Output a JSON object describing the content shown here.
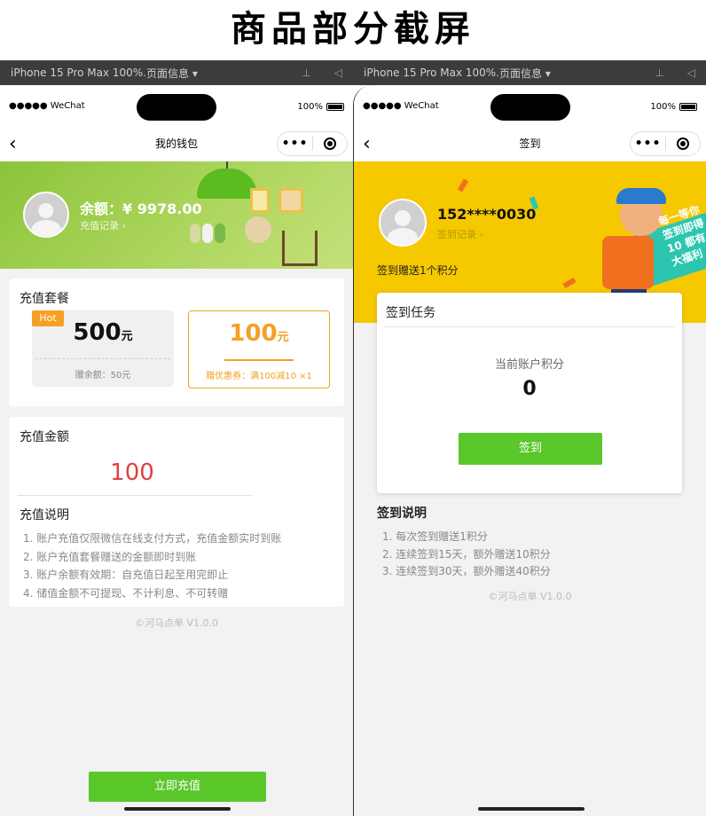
{
  "heading": "商品部分截屏",
  "devtools": {
    "device_label": "iPhone 15 Pro Max 100%...",
    "menu_label": "页面信息 ▾",
    "pin_icon": "pin-icon",
    "speaker_icon": "speaker-icon"
  },
  "status_bar": {
    "carrier": "●●●●● WeChat",
    "battery_pct": "100%"
  },
  "wallet": {
    "nav_title": "我的钱包",
    "back_glyph": "‹",
    "capsule_dots": "•••",
    "balance_label": "余额：",
    "balance_value": "¥ 9978.00",
    "recharge_record": "充值记录 ›",
    "package_section_title": "充值套餐",
    "packages": [
      {
        "badge": "Hot",
        "amount": "500",
        "unit": "元",
        "note": "赠余额：50元"
      },
      {
        "badge": "",
        "amount": "100",
        "unit": "元",
        "note": "赠优惠券：满100减10 ×1"
      }
    ],
    "amount_section_title": "充值金额",
    "amount_value": "100",
    "desc_title": "充值说明",
    "desc_items": [
      "1. 账户充值仅限微信在线支付方式，充值金额实时到账",
      "2. 账户充值套餐赠送的金额即时到账",
      "3. 账户余额有效期：自充值日起至用完即止",
      "4. 储值金额不可提现、不计利息、不可转赠"
    ],
    "copyright": "©河马点单 V1.0.0",
    "recharge_button": "立即充值"
  },
  "signin": {
    "nav_title": "签到",
    "phone_number": "152****0030",
    "sign_record": "签到记录 ›",
    "sign_bonus": "签到赠送1个积分",
    "banner_text": "每一等你 签到即得10 都有大福利",
    "task_title": "签到任务",
    "points_label": "当前账户积分",
    "points_value": "0",
    "sign_button": "签到",
    "desc_title": "签到说明",
    "desc_items": [
      "1. 每次签到赠送1积分",
      "2. 连续签到15天，额外赠送10积分",
      "3. 连续签到30天，额外赠送40积分"
    ],
    "copyright": "©河马点单 V1.0.0"
  },
  "colors": {
    "accent_green": "#5ac72b",
    "accent_orange": "#f5a023",
    "amount_red": "#e04040",
    "banner_yellow": "#f5c800",
    "banner_green": "#a9d45a"
  }
}
